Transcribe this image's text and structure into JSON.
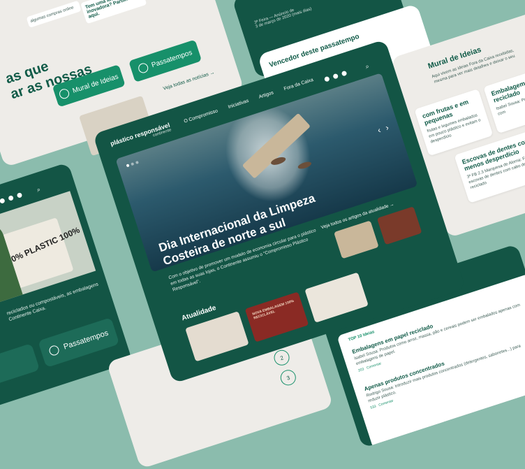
{
  "top_left": {
    "headline_lines": [
      "as que",
      "ar as nossas"
    ],
    "snippet_1": "algumas compras online",
    "idea_prompt": "Tem uma ideia inovadora? Partilhe-a aqui.",
    "snippet_2": "algum",
    "buttons": [
      "Mural de Ideias",
      "Passatempos"
    ],
    "news_link": "Veja todas as notícias"
  },
  "top_center": {
    "snippet_date": "3ª Feira — Anúncio de",
    "snippet_date_2": "3 de março de 2020 (mais dias)",
    "section_title": "Vencedor deste passatempo",
    "snippet_body": "Parabéns a João Sousa, o grande vencedor do passatempo"
  },
  "top_right": {
    "title": "Mural de Ideias",
    "subtitle": "Aqui vivem as ideias Fora da Caixa recebidas, mesma para ver mais detalhes e deixar o seu",
    "cards": [
      {
        "title": "com frutas e em pequenas",
        "body": "frutas e legumes embalados em pouco plástico e evitam o desperdício"
      },
      {
        "title": "Embalagem reciclado",
        "body": "Isabel Sousa: Produtos com"
      },
      {
        "title": "Escovas de dentes com menos desperdício",
        "body": "3ª FB 2.3 Marquesa de Alorna: Fabricar escovas de dentes com cabo de plástico reciclado"
      }
    ]
  },
  "left": {
    "hero_text": "0% PLASTIC 100%",
    "body": "reciclados ou compostáveis, as embalagens Continente Caixa.",
    "buttons": [
      "",
      "Passatempos"
    ]
  },
  "main": {
    "logo": "plástico responsável",
    "logo_sub": "continente",
    "nav": [
      "O Compromisso",
      "Iniciativas",
      "Artigos",
      "Fora da Caixa"
    ],
    "hero_title": "Dia Internacional da Limpeza Costeira de norte a sul",
    "hero_body": "Com o objetivo de promover um modelo de economia circular para o plástico em todas as suas lojas, o Continente assumiu o \"Compromisso Plástico Responsável\".",
    "articles_link": "Veja todos os artigos da atualidade",
    "section": "Atualidade",
    "tile_text": "NOVA EMBALAGEM 100% RECICLÁVEL",
    "prev": "‹",
    "next": "›"
  },
  "bottom_right": {
    "title": "Vote aqui nas melhores ideias",
    "tab": "TOP 10 Ideias",
    "ideas": [
      {
        "title": "Embalagens em papel reciclado",
        "body": "Isabel Sousa: Produtos como arroz, massa, pão e cereais podem ser embalados apenas com embalagens de papel.",
        "votes": "203",
        "action": "Comentar"
      },
      {
        "title": "Apenas produtos concentrados",
        "body": "Rodrigo Sousa: Introduzir mais produtos concentrados (detergentes, sabonetes...) para reduzir plástico.",
        "votes": "533",
        "action": "Comentar"
      }
    ]
  },
  "bottom_center": {
    "numbers": [
      "1",
      "2",
      "3"
    ]
  },
  "colors": {
    "brand": "#135545",
    "accent": "#17906a",
    "background": "#8bbcad"
  }
}
